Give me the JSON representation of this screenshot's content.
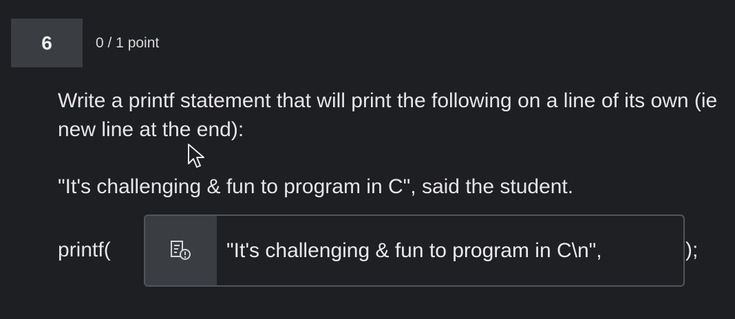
{
  "question": {
    "number": "6",
    "points": "0 / 1 point",
    "prompt": "Write a printf statement that will print the following on a line of its own (ie new line at the end):",
    "quote": "\"It's challenging & fun to program in C\", said the student."
  },
  "answer": {
    "prefix": "printf(",
    "value": "\"It's challenging & fun to program in C\\n\",",
    "suffix": ");",
    "status_icon": "incorrect-answer-icon"
  }
}
